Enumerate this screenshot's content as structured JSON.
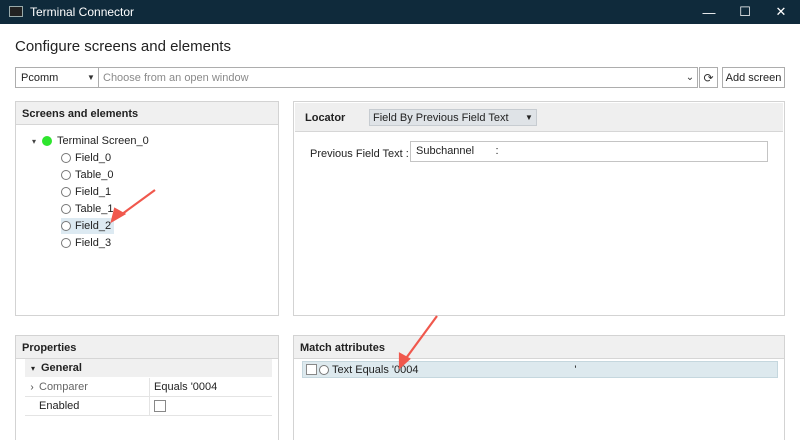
{
  "window": {
    "title": "Terminal Connector",
    "icon": "terminal-app-icon",
    "controls": {
      "minimize": "—",
      "maximize": "☐",
      "close": "✕"
    }
  },
  "heading": "Configure screens and elements",
  "toolbar": {
    "provider_value": "Pcomm",
    "window_placeholder": "Choose from an open window",
    "refresh_icon": "refresh-icon",
    "add_screen_label": "Add screen"
  },
  "screens_panel": {
    "header": "Screens and elements",
    "root": {
      "label": "Terminal Screen_0",
      "status_color": "#2ee52e"
    },
    "items": [
      {
        "label": "Field_0"
      },
      {
        "label": "Table_0"
      },
      {
        "label": "Field_1"
      },
      {
        "label": "Table_1"
      },
      {
        "label": "Field_2",
        "selected": true
      },
      {
        "label": "Field_3"
      }
    ]
  },
  "locator_panel": {
    "label": "Locator",
    "selected": "Field By Previous Field Text",
    "field_label": "Previous Field Text :",
    "field_value": "Subchannel       :"
  },
  "properties_panel": {
    "header": "Properties",
    "group": "General",
    "rows": [
      {
        "name": "Comparer",
        "value": "Equals '0004"
      },
      {
        "name": "Enabled",
        "value": ""
      }
    ]
  },
  "match_panel": {
    "header": "Match attributes",
    "row_text": "Text Equals '0004                                                   '"
  },
  "colors": {
    "titlebar": "#0f2a3b",
    "annotation_arrow": "#f0584d",
    "selection": "#ddeaf2"
  }
}
